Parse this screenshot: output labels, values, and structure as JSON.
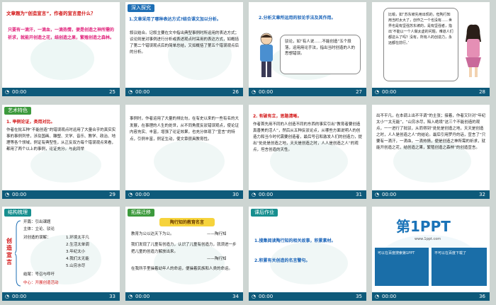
{
  "footer_time": "00:00",
  "slides": [
    {
      "num": "25",
      "heading": "文章题为“创造宣言”，作者的宣言是什么？",
      "body": "只要有一滴汗，一滴血，一滴热情，便是创造之神所需的祈求，就能开创造之花，结创造之果，繁殖创造之森林。"
    },
    {
      "num": "26",
      "tag": "深入探究",
      "heading": "1.文章采用了哪种表达方式?结合课文加以分析。",
      "body": "叙议结合。记叙主要在文中指出典型事例时所运用的表达方式；议论则是对事例进行分析或表述观点时采用的表达方式，如概括了第二个错误观点后的简单总结，又如概括了第五个错误观点后的分析。"
    },
    {
      "num": "27",
      "heading": "2.分析文章所运用的驳论手法及其作用。",
      "bubble": "驳论，如“有人说……不能创造”五个段落，运用用论手法，指出当时创造的人的思想错误。"
    },
    {
      "num": "28",
      "bubble": "比喻，如“苏东坡先用出现的，但陶行知用当时太大了，创作之一个也没有……世界也是有坚强苏东坡的，是有坚强者，指出‘不能以一个人做太虚的问题，难道人们都这么了吗？没有，所有人的创造力，永远都在前行。’"
    },
    {
      "num": "29",
      "tag": "艺术特色",
      "heading": "1. 举例论证，类用对比。",
      "body": "作者在批五种“不能创造”的错误观点时运用了大量合乎的真实实事的事例列举，涉及国画、雕塑、文学、音乐、教学、政治、地理等各个领域，例证有典型性，从正反双方每个错误观点来看，都用了两个以上的事例，论证充分。与此同举"
    },
    {
      "num": "30",
      "body": "事例时，作者运用了大量的排比句，在有史以来的一些有名的大发展，在事理的人生的处世，从不同角度反驳错误观点，使论证内容充实、丰富，增强了论证效果，也充分体现了“宣言”的特点，引例丰富，例证生动，使文章很具教育性。"
    },
    {
      "num": "31",
      "heading": "2. 有破有立，思路清晰。",
      "body": "作者首先用不同的人创造不同的东西的事实引出“教育者要创造真善美的活人”，然后从五种反驳论点，从哪些方面说明人的创造力和当今时代需要创造者，最后号召和激发人们的创造力，提出“处处是创造之地，天天是创造之时，人人是创造之人”的观点，坦言创造的天性。"
    },
    {
      "num": "32",
      "body": "出不平凡，在本调上出不平调”的主张；接着，作者又针对“年纪太小”“太无能”，“山穷水尽，陷入绝境”这三个不能创造的观点，一一进行了批驳，从而得到“处处是创造之地，天天是创造之时，人人是创造之人”的结论。最后引用罗丹的话，宣言了“只要有一滴汗，一滴血，一滴热情，便是创造之神所需的祈求，就能开创造之花，结创造之果，繁殖创造之森林”的创造宣言。"
    },
    {
      "num": "33",
      "tag": "结构梳理",
      "tree": {
        "root": "创造宣言",
        "items": [
          "开篇：引出课题",
          "主体：立论、驳论",
          "对创造的误解：",
          "1.环境太平凡",
          "2.生活太单调",
          "3.年纪太小",
          "4.我们太无能",
          "5.山穷水尽",
          "结尾：号召与呼吁",
          "中心：开展创造活动"
        ]
      }
    },
    {
      "num": "34",
      "tag": "拓展迁移",
      "heading": "陶行知的教育名言",
      "quotes": [
        {
          "text": "教育为公以达天下为公。",
          "author": "——陶行知"
        },
        {
          "text": "我们发现了儿童有创造力，认识了儿童有创造力，就须进一步把儿童的创造力解放出来。",
          "author": "——陶行知"
        },
        {
          "text": "在我所手里操着幼年人的命运，便操着民族和人类的命运。",
          "author": "——陶行知"
        }
      ]
    },
    {
      "num": "35",
      "tag": "课后作业",
      "tasks": [
        "1.搜集阅读陶行知的相关故事，积累素材。",
        "2.积累有关创造的名言警句。"
      ]
    },
    {
      "num": "36",
      "logo": "第1PPT",
      "logo_sub": "www.1ppt.com",
      "banner1": "可以在百度搜索第1PPT",
      "banner2": "不可以在百度下载了"
    }
  ]
}
